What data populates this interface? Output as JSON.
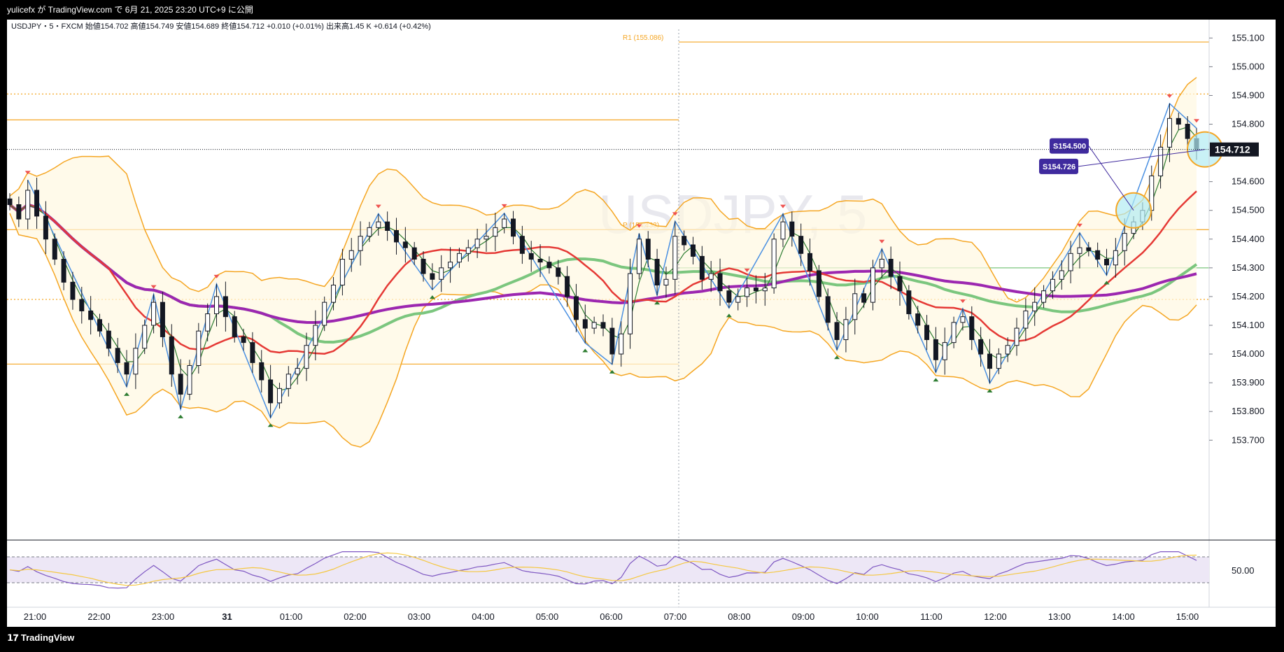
{
  "publish_line": "yulicefx が TradingView.com で 6月 21, 2025 23:20 UTC+9 に公開",
  "footer_brand": "TradingView",
  "chart_data": {
    "type": "candlestick",
    "symbol": "USDJPY",
    "watermark": "USDJPY, 5",
    "header_text": "USDJPY・5・FXCM  始値154.702  高値154.749  安値154.689  終値154.712  +0.010 (+0.01%)  出来高1.45 K  +0.614 (+0.42%)",
    "price_axis": {
      "min": 153.63,
      "max": 155.13,
      "ticks": [
        "155.100",
        "155.000",
        "154.900",
        "154.800",
        "154.600",
        "154.500",
        "154.400",
        "154.300",
        "154.200",
        "154.100",
        "154.000",
        "153.900",
        "153.800",
        "153.700"
      ]
    },
    "last_price": "154.712",
    "time_axis": [
      "21:00",
      "22:00",
      "23:00",
      "31",
      "01:00",
      "02:00",
      "03:00",
      "04:00",
      "05:00",
      "06:00",
      "07:00",
      "08:00",
      "09:00",
      "10:00",
      "11:00",
      "12:00",
      "13:00",
      "14:00",
      "15:00"
    ],
    "levels": [
      {
        "label": "R1 (155.086)",
        "price": 155.086,
        "style": "solid",
        "color": "#f5a623",
        "partial": true
      },
      {
        "label": "",
        "price": 154.905,
        "style": "dotted",
        "color": "#f5a623"
      },
      {
        "label": "",
        "price": 154.815,
        "style": "solid",
        "color": "#f5a623",
        "partial": false
      },
      {
        "label": "P (154.433)",
        "price": 154.433,
        "style": "solid",
        "color": "#f5a623"
      },
      {
        "label": "",
        "price": 154.19,
        "style": "dotted",
        "color": "#f5a623"
      },
      {
        "label": "",
        "price": 153.965,
        "style": "solid",
        "color": "#f5a623",
        "partial": false
      },
      {
        "label": "",
        "price": 154.3,
        "style": "solid",
        "color": "#7bc67e",
        "partial": true
      }
    ],
    "annotations": [
      {
        "label": "S154.726",
        "price": 154.726
      },
      {
        "label": "S154.500",
        "price": 154.5
      }
    ],
    "close_series": [
      154.52,
      154.47,
      154.57,
      154.48,
      154.4,
      154.33,
      154.25,
      154.19,
      154.15,
      154.12,
      154.08,
      154.02,
      153.97,
      153.93,
      154.02,
      154.1,
      154.18,
      154.06,
      153.93,
      153.86,
      153.96,
      154.08,
      154.14,
      154.2,
      154.13,
      154.06,
      154.04,
      153.97,
      153.91,
      153.83,
      153.88,
      153.93,
      153.95,
      154.03,
      154.1,
      154.18,
      154.24,
      154.33,
      154.36,
      154.41,
      154.44,
      154.46,
      154.43,
      154.39,
      154.37,
      154.33,
      154.28,
      154.26,
      154.3,
      154.32,
      154.35,
      154.37,
      154.4,
      154.41,
      154.44,
      154.47,
      154.41,
      154.35,
      154.33,
      154.32,
      154.3,
      154.27,
      154.2,
      154.12,
      154.09,
      154.11,
      154.09,
      154.0,
      154.07,
      154.28,
      154.4,
      154.33,
      154.24,
      154.26,
      154.41,
      154.38,
      154.34,
      154.26,
      154.28,
      154.22,
      154.18,
      154.2,
      154.23,
      154.22,
      154.23,
      154.4,
      154.46,
      154.41,
      154.35,
      154.29,
      154.2,
      154.11,
      154.05,
      154.12,
      154.21,
      154.18,
      154.3,
      154.33,
      154.27,
      154.22,
      154.14,
      154.1,
      154.05,
      153.98,
      154.04,
      154.11,
      154.13,
      154.05,
      154.0,
      153.95,
      154.0,
      154.03,
      154.09,
      154.15,
      154.18,
      154.22,
      154.26,
      154.29,
      154.35,
      154.37,
      154.36,
      154.33,
      154.31,
      154.36,
      154.42,
      154.46,
      154.5,
      154.62,
      154.72,
      154.82,
      154.8,
      154.75,
      154.712
    ],
    "rsi": {
      "level_label": "50.00"
    }
  }
}
